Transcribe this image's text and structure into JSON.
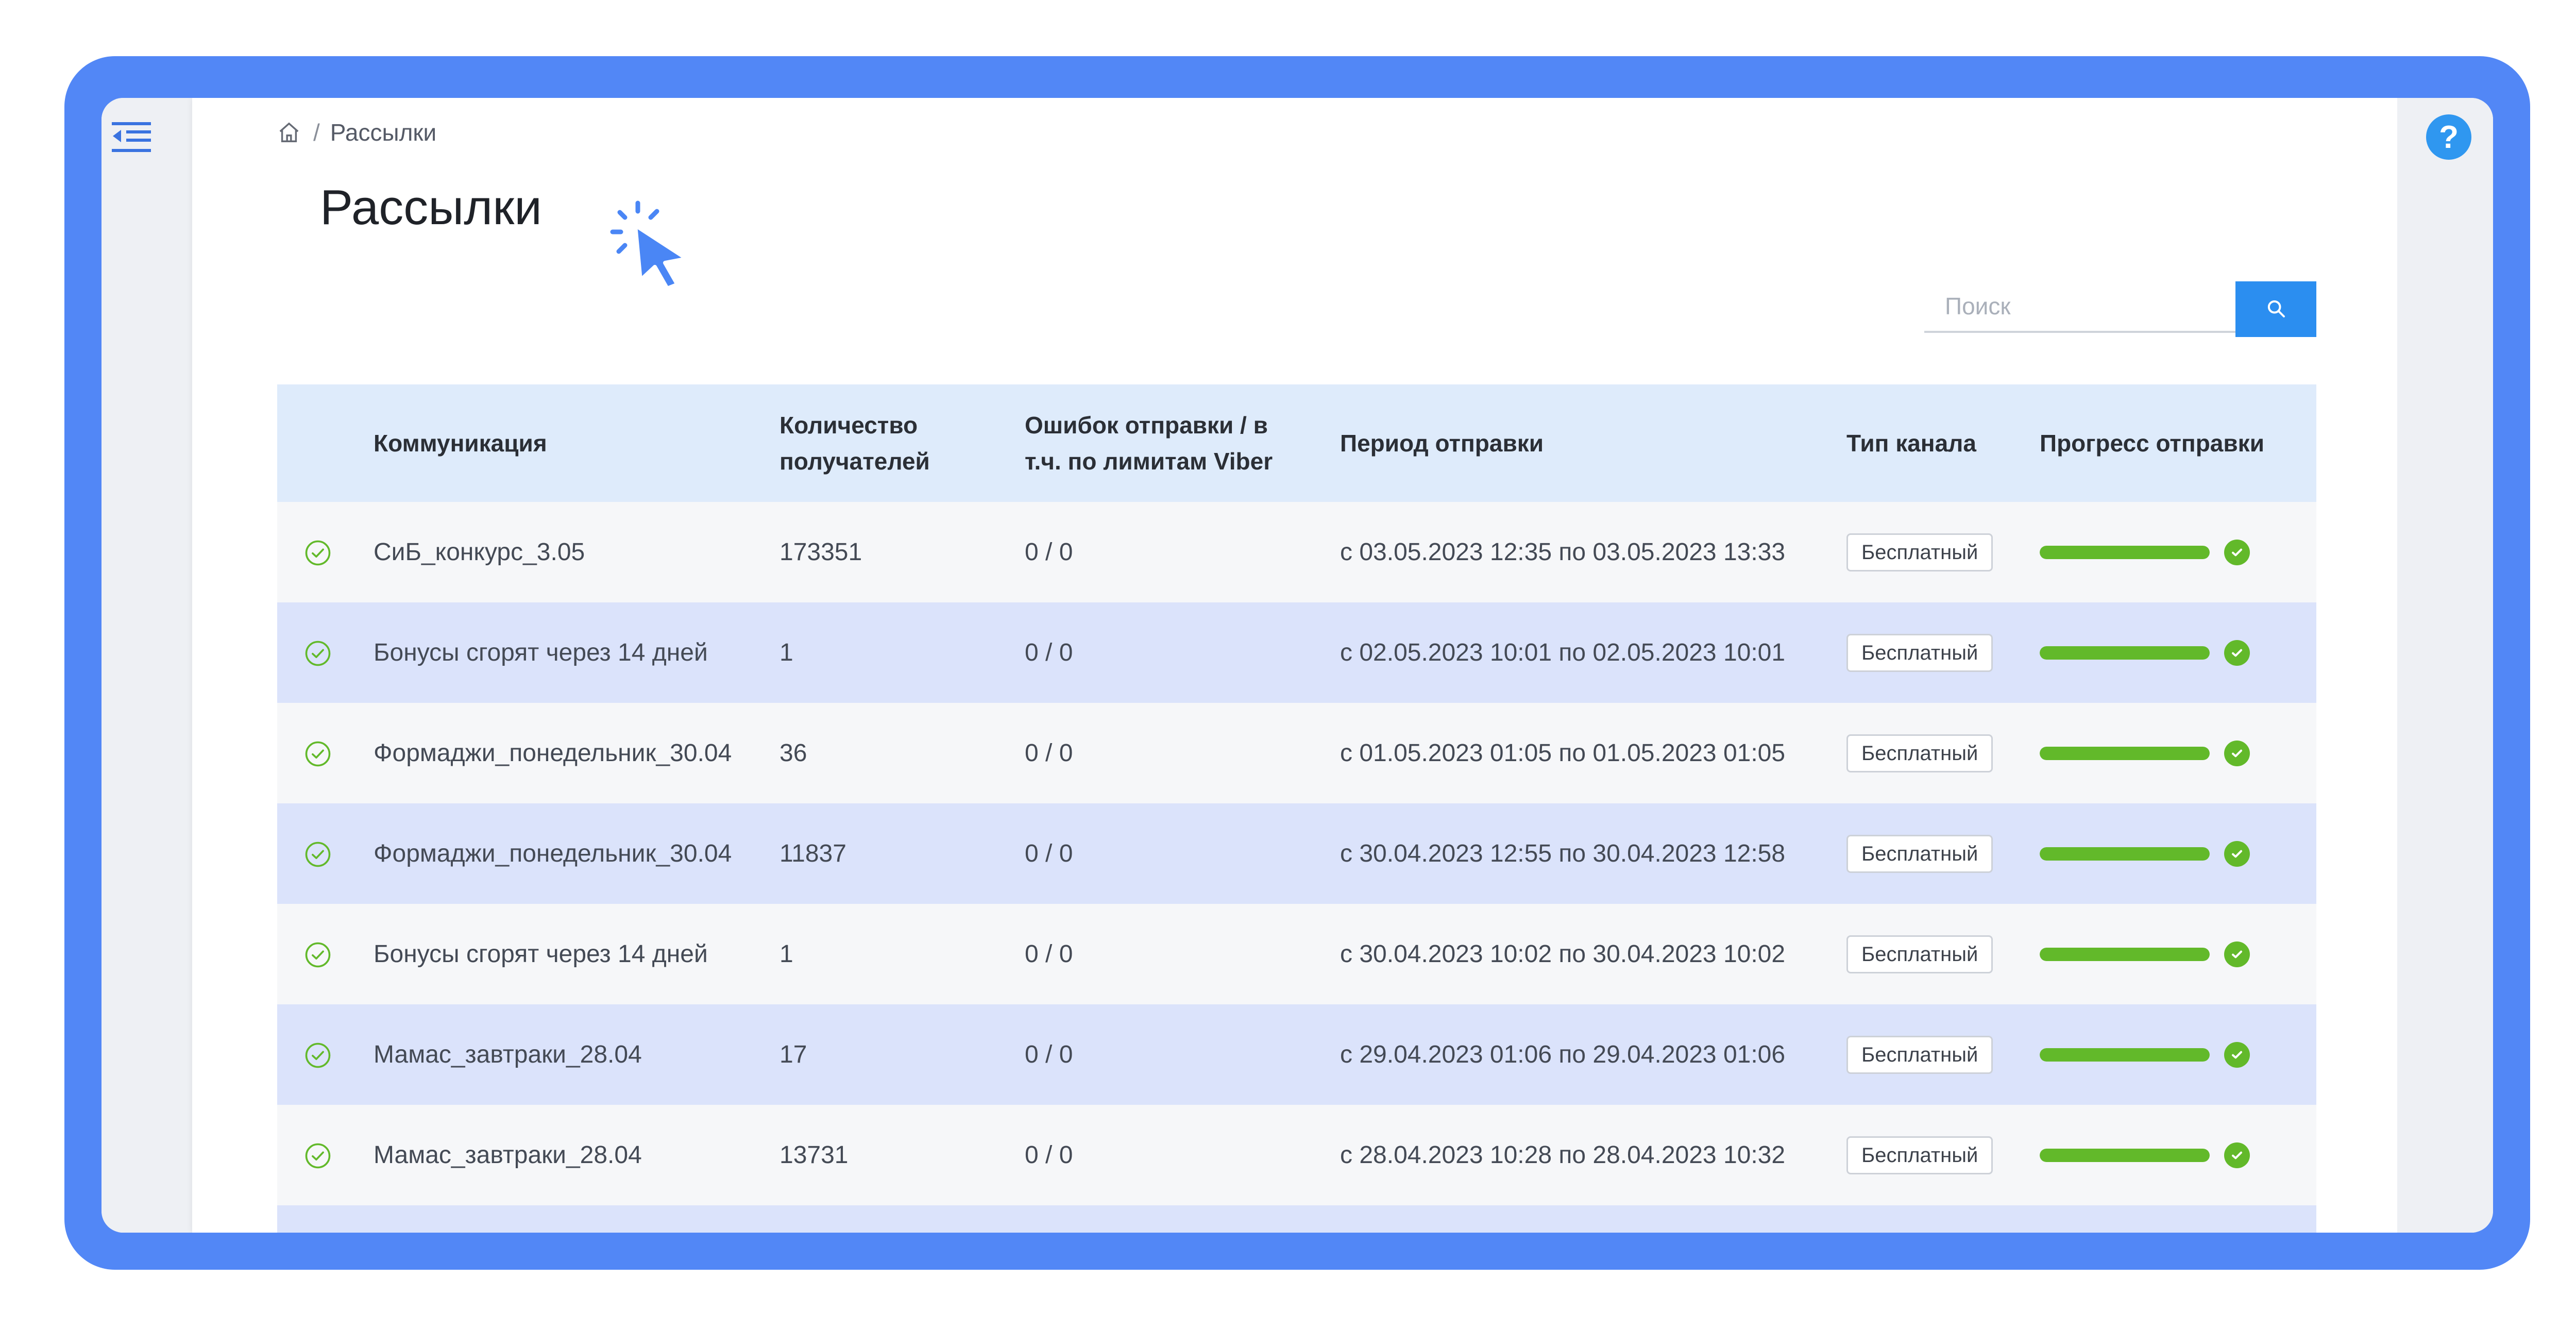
{
  "breadcrumb": {
    "home_icon": "home-icon",
    "separator": "/",
    "current": "Рассылки"
  },
  "page": {
    "title": "Рассылки"
  },
  "search": {
    "placeholder": "Поиск",
    "value": "",
    "icon": "search-icon"
  },
  "help": {
    "label": "?"
  },
  "colors": {
    "frame": "#5287f6",
    "header_bg": "#deebfb",
    "row_alt": "#dbe3fb",
    "progress": "#62b92a",
    "accent": "#2b8ef0"
  },
  "table": {
    "columns": [
      "Коммуникация",
      "Количество получателей",
      "Ошибок отправки / в т.ч. по лимитам Viber",
      "Период отправки",
      "Тип канала",
      "Прогресс отправки"
    ],
    "rows": [
      {
        "name": "СиБ_конкурс_3.05",
        "recipients": "173351",
        "errors": "0 / 0",
        "period": "с 03.05.2023 12:35 по 03.05.2023 13:33",
        "channel": "Бесплатный",
        "progress": 1.0
      },
      {
        "name": "Бонусы сгорят через 14 дней",
        "recipients": "1",
        "errors": "0 / 0",
        "period": "с 02.05.2023 10:01 по 02.05.2023 10:01",
        "channel": "Бесплатный",
        "progress": 1.0
      },
      {
        "name": "Формаджи_понедельник_30.04",
        "recipients": "36",
        "errors": "0 / 0",
        "period": "с 01.05.2023 01:05 по 01.05.2023 01:05",
        "channel": "Бесплатный",
        "progress": 1.0
      },
      {
        "name": "Формаджи_понедельник_30.04",
        "recipients": "11837",
        "errors": "0 / 0",
        "period": "с 30.04.2023 12:55 по 30.04.2023 12:58",
        "channel": "Бесплатный",
        "progress": 1.0
      },
      {
        "name": "Бонусы сгорят через 14 дней",
        "recipients": "1",
        "errors": "0 / 0",
        "period": "с 30.04.2023 10:02 по 30.04.2023 10:02",
        "channel": "Бесплатный",
        "progress": 1.0
      },
      {
        "name": "Мамас_завтраки_28.04",
        "recipients": "17",
        "errors": "0 / 0",
        "period": "с 29.04.2023 01:06 по 29.04.2023 01:06",
        "channel": "Бесплатный",
        "progress": 1.0
      },
      {
        "name": "Мамас_завтраки_28.04",
        "recipients": "13731",
        "errors": "0 / 0",
        "period": "с 28.04.2023 10:28 по 28.04.2023 10:32",
        "channel": "Бесплатный",
        "progress": 1.0
      }
    ]
  }
}
